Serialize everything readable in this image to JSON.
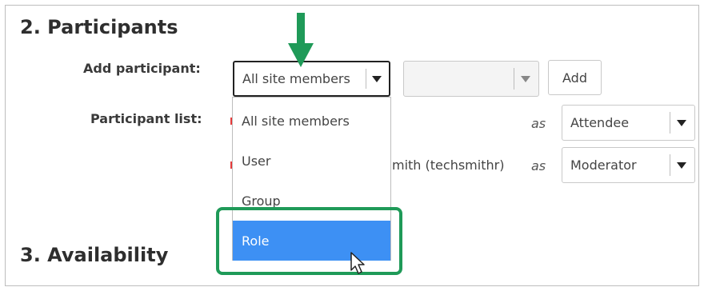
{
  "participants": {
    "title": "2. Participants",
    "add_label": "Add participant:",
    "list_label": "Participant list:",
    "type_select": {
      "value": "All site members"
    },
    "add_button": "Add",
    "dropdown": {
      "options": [
        "All site members",
        "User",
        "Group",
        "Role"
      ],
      "selected": "Role"
    },
    "rows": [
      {
        "name": "",
        "as": "as",
        "role": "Attendee"
      },
      {
        "name": "mith (techsmithr)",
        "as": "as",
        "role": "Moderator"
      }
    ]
  },
  "availability": {
    "title": "3. Availability"
  },
  "annotations": {
    "arrow_color": "#1f9a58",
    "highlight_color": "#1f9a58",
    "selected_color": "#3d90f4"
  }
}
